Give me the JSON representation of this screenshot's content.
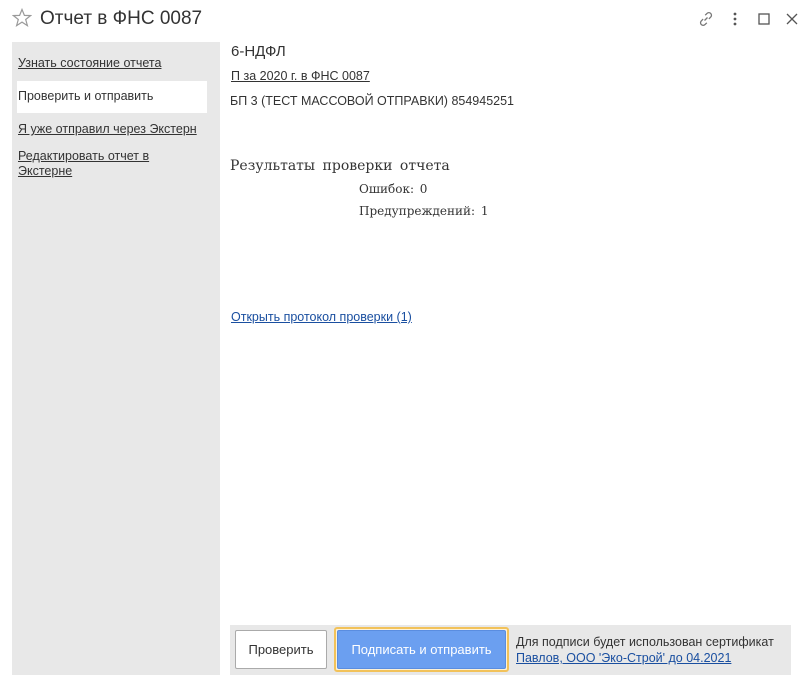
{
  "window": {
    "title": "Отчет в ФНС 0087",
    "icons": [
      "star-icon",
      "link-icon",
      "more-icon",
      "maximize-icon",
      "close-icon"
    ]
  },
  "sidebar": {
    "items": [
      {
        "label": "Узнать состояние отчета",
        "active": false
      },
      {
        "label": "Проверить и отправить",
        "active": true
      },
      {
        "label": "Я уже отправил через Экстерн",
        "active": false
      },
      {
        "label": "Редактировать отчет в Экстерне",
        "active": false
      }
    ]
  },
  "report": {
    "form_name": "6-НДФЛ",
    "period_link": "П за 2020 г. в ФНС 0087",
    "organization": "БП 3 (ТЕСТ МАССОВОЙ ОТПРАВКИ) 854945251"
  },
  "results": {
    "title": "Результаты проверки отчета",
    "errors_line": "Ошибок: 0",
    "warnings_line": "Предупреждений: 1",
    "protocol_link": "Открыть протокол проверки (1)"
  },
  "footer": {
    "check_button": "Проверить",
    "sign_send_button": "Подписать и отправить",
    "cert_text": "Для подписи будет использован сертификат",
    "cert_link": "Павлов, ООО 'Эко-Строй' до 04.2021"
  },
  "colors": {
    "accent": "#6b9ff0",
    "accent_focus": "#f2c25a",
    "link": "#1a4fa0",
    "panel": "#e8e8e8"
  }
}
